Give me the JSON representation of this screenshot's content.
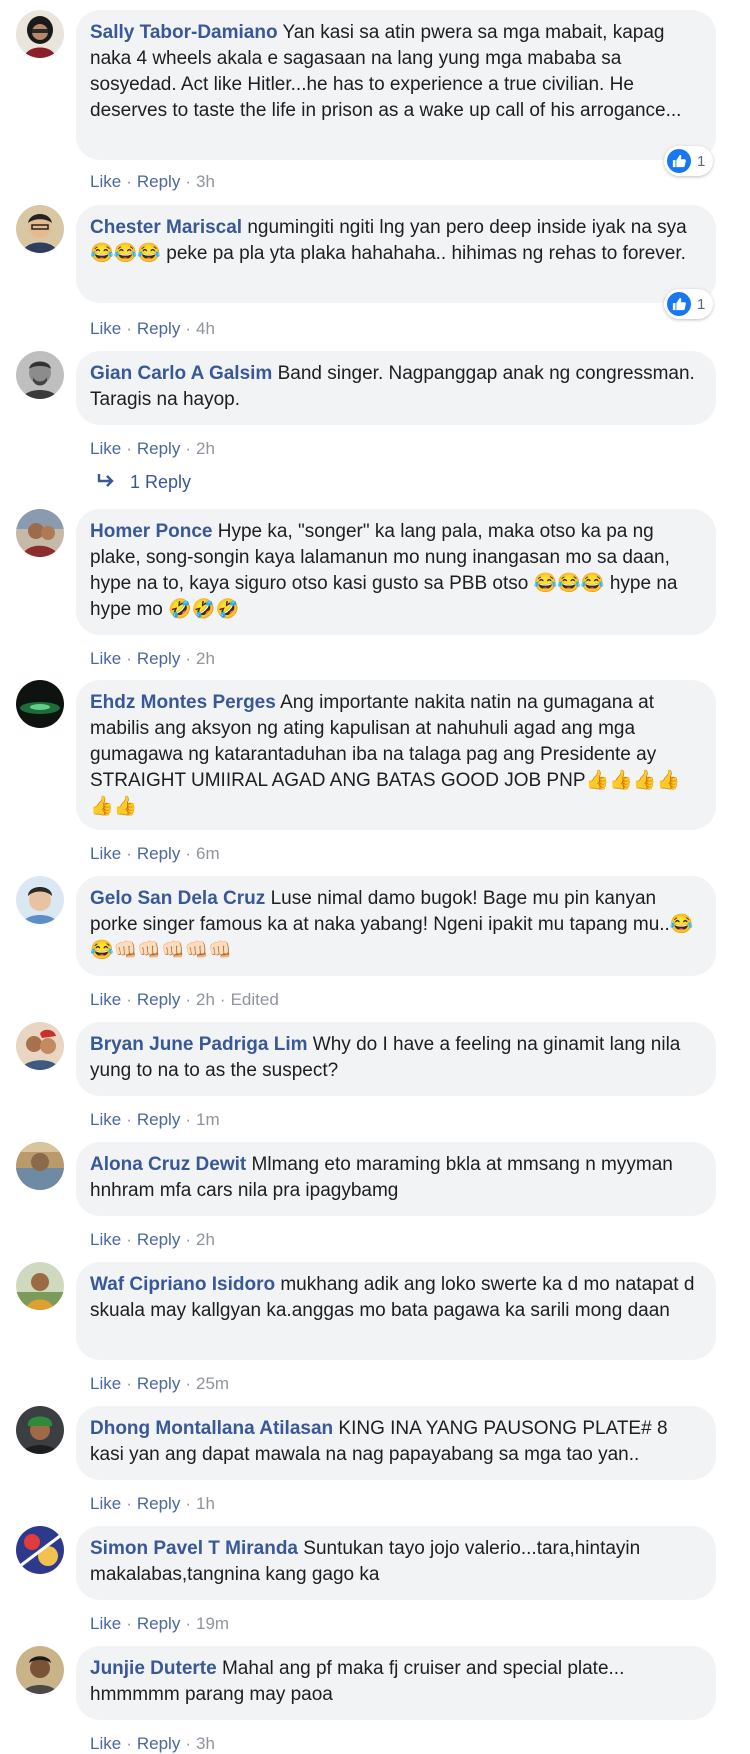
{
  "comments": [
    {
      "name": "Sally Tabor-Damiano",
      "text": "Yan kasi sa atin pwera sa mga mabait, kapag naka 4 wheels akala e sagasaan na lang yung mga mababa sa sosyedad. Act like Hitler...he has to experience a true civilian. He deserves to taste the life in prison as a wake up call of his arrogance...",
      "like": "Like",
      "reply": "Reply",
      "time": "3h",
      "reactions": "1"
    },
    {
      "name": "Chester Mariscal",
      "text": "ngumingiti ngiti lng yan pero deep inside iyak na sya😂😂😂 peke pa pla yta plaka hahahaha.. hihimas ng rehas to forever.",
      "like": "Like",
      "reply": "Reply",
      "time": "4h",
      "reactions": "1"
    },
    {
      "name": "Gian Carlo A Galsim",
      "text": "Band singer. Nagpanggap anak ng congressman. Taragis na hayop.",
      "like": "Like",
      "reply": "Reply",
      "time": "2h",
      "replies_label": "1 Reply"
    },
    {
      "name": "Homer Ponce",
      "text": "Hype ka, \"songer\" ka lang pala, maka otso ka pa ng plake, song-songin kaya lalamanun mo nung inangasan mo sa daan, hype na to, kaya siguro otso kasi gusto sa PBB otso 😂😂😂 hype na hype mo 🤣🤣🤣",
      "like": "Like",
      "reply": "Reply",
      "time": "2h"
    },
    {
      "name": "Ehdz Montes Perges",
      "text": "Ang importante nakita natin na gumagana at mabilis ang aksyon ng ating kapulisan at nahuhuli agad ang mga gumagawa ng katarantaduhan iba na talaga pag ang Presidente ay STRAIGHT UMIIRAL AGAD ANG BATAS GOOD JOB PNP👍👍👍👍👍👍",
      "like": "Like",
      "reply": "Reply",
      "time": "6m"
    },
    {
      "name": "Gelo San Dela Cruz",
      "text": "Luse nimal damo bugok! Bage mu pin kanyan porke singer famous ka at naka yabang! Ngeni ipakit mu tapang mu..😂😂👊🏻👊🏻👊🏻👊🏻👊🏻",
      "like": "Like",
      "reply": "Reply",
      "time": "2h",
      "edited": "Edited"
    },
    {
      "name": "Bryan June Padriga Lim",
      "text": "Why do I have a feeling na ginamit lang nila yung to na to as the suspect?",
      "like": "Like",
      "reply": "Reply",
      "time": "1m"
    },
    {
      "name": "Alona Cruz Dewit",
      "text": "Mlmang eto maraming bkla at mmsang n myyman hnhram mfa cars nila pra ipagybamg",
      "like": "Like",
      "reply": "Reply",
      "time": "2h"
    },
    {
      "name": "Waf Cipriano Isidoro",
      "text": "mukhang adik ang loko swerte ka d mo natapat d skuala may kallgyan ka.anggas mo bata pagawa ka sarili mong daan",
      "like": "Like",
      "reply": "Reply",
      "time": "25m"
    },
    {
      "name": "Dhong Montallana Atilasan",
      "text": "KING INA YANG PAUSONG PLATE# 8 kasi yan ang dapat mawala na nag papayabang sa mga tao yan..",
      "like": "Like",
      "reply": "Reply",
      "time": "1h"
    },
    {
      "name": "Simon Pavel T Miranda",
      "text": "Suntukan tayo jojo valerio...tara,hintayin makalabas,tangnina kang gago ka",
      "like": "Like",
      "reply": "Reply",
      "time": "19m"
    },
    {
      "name": "Junjie Duterte",
      "text": "Mahal ang pf maka fj cruiser and special plate... hmmmmm parang may paoa",
      "like": "Like",
      "reply": "Reply",
      "time": "3h"
    }
  ],
  "colors": {
    "name": "#385898",
    "bubble": "#f2f3f5",
    "meta": "#90949c",
    "like_blue": "#1877f2"
  }
}
